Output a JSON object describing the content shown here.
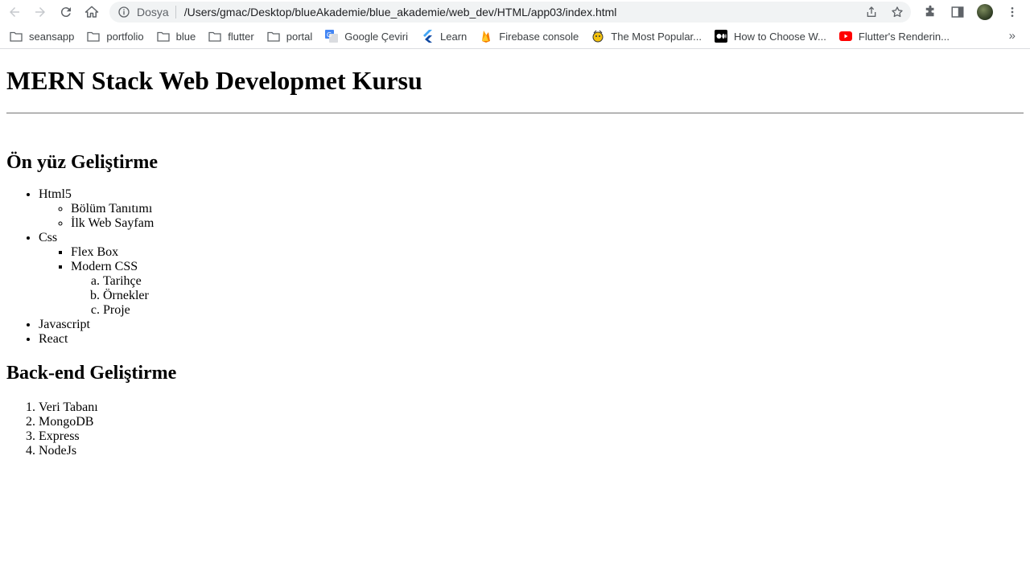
{
  "browser": {
    "scheme_label": "Dosya",
    "url": "/Users/gmac/Desktop/blueAkademie/blue_akademie/web_dev/HTML/app03/index.html"
  },
  "bookmarks": [
    {
      "label": "seansapp",
      "icon": "folder-icon"
    },
    {
      "label": "portfolio",
      "icon": "folder-icon"
    },
    {
      "label": "blue",
      "icon": "folder-icon"
    },
    {
      "label": "flutter",
      "icon": "folder-icon"
    },
    {
      "label": "portal",
      "icon": "folder-icon"
    },
    {
      "label": "Google Çeviri",
      "icon": "google-translate-icon"
    },
    {
      "label": "Learn",
      "icon": "flutter-icon"
    },
    {
      "label": "Firebase console",
      "icon": "firebase-icon"
    },
    {
      "label": "The Most Popular...",
      "icon": "site-icon"
    },
    {
      "label": "How to Choose W...",
      "icon": "medium-icon"
    },
    {
      "label": "Flutter's Renderin...",
      "icon": "youtube-icon"
    }
  ],
  "page": {
    "title": "MERN Stack Web Developmet Kursu",
    "frontend": {
      "heading": "Ön yüz Geliştirme",
      "html5": "Html5",
      "html5_items": [
        "Bölüm Tanıtımı",
        "İlk Web Sayfam"
      ],
      "css": "Css",
      "css_flex": "Flex Box",
      "css_modern": "Modern CSS",
      "modern_items": [
        "Tarihçe",
        "Örnekler",
        "Proje"
      ],
      "javascript": "Javascript",
      "react": "React"
    },
    "backend": {
      "heading": "Back-end Geliştirme",
      "items": [
        "Veri Tabanı",
        "MongoDB",
        "Express",
        "NodeJs"
      ]
    }
  },
  "colors": {
    "toolbar_icon": "#5f6368",
    "omnibox_bg": "#f1f3f4",
    "hr": "#808080"
  }
}
